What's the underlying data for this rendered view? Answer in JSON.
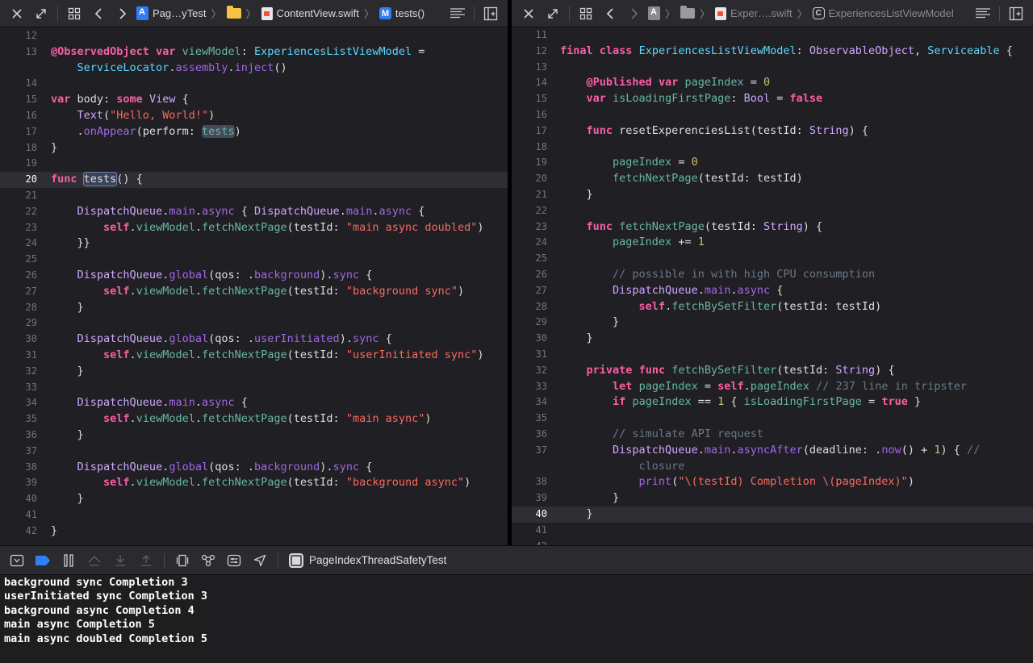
{
  "left_editor": {
    "breadcrumbs": [
      "Pag…yTest",
      "ContentView.swift",
      "tests()"
    ],
    "current_line": 20,
    "lines": [
      {
        "n": "12",
        "t": ""
      },
      {
        "n": "13",
        "t": "@ObservedObject var viewModel: ExperiencesListViewModel ="
      },
      {
        "n": "",
        "t": "    ServiceLocator.assembly.inject()"
      },
      {
        "n": "14",
        "t": ""
      },
      {
        "n": "15",
        "t": "var body: some View {"
      },
      {
        "n": "16",
        "t": "    Text(\"Hello, World!\")"
      },
      {
        "n": "17",
        "t": "    .onAppear(perform: tests)"
      },
      {
        "n": "18",
        "t": "}"
      },
      {
        "n": "19",
        "t": ""
      },
      {
        "n": "20",
        "t": "func tests() {"
      },
      {
        "n": "21",
        "t": ""
      },
      {
        "n": "22",
        "t": "    DispatchQueue.main.async { DispatchQueue.main.async {"
      },
      {
        "n": "23",
        "t": "        self.viewModel.fetchNextPage(testId: \"main async doubled\")"
      },
      {
        "n": "24",
        "t": "    }}"
      },
      {
        "n": "25",
        "t": ""
      },
      {
        "n": "26",
        "t": "    DispatchQueue.global(qos: .background).sync {"
      },
      {
        "n": "27",
        "t": "        self.viewModel.fetchNextPage(testId: \"background sync\")"
      },
      {
        "n": "28",
        "t": "    }"
      },
      {
        "n": "29",
        "t": ""
      },
      {
        "n": "30",
        "t": "    DispatchQueue.global(qos: .userInitiated).sync {"
      },
      {
        "n": "31",
        "t": "        self.viewModel.fetchNextPage(testId: \"userInitiated sync\")"
      },
      {
        "n": "32",
        "t": "    }"
      },
      {
        "n": "33",
        "t": ""
      },
      {
        "n": "34",
        "t": "    DispatchQueue.main.async {"
      },
      {
        "n": "35",
        "t": "        self.viewModel.fetchNextPage(testId: \"main async\")"
      },
      {
        "n": "36",
        "t": "    }"
      },
      {
        "n": "37",
        "t": ""
      },
      {
        "n": "38",
        "t": "    DispatchQueue.global(qos: .background).sync {"
      },
      {
        "n": "39",
        "t": "        self.viewModel.fetchNextPage(testId: \"background async\")"
      },
      {
        "n": "40",
        "t": "    }"
      },
      {
        "n": "41",
        "t": ""
      },
      {
        "n": "42",
        "t": "}"
      }
    ]
  },
  "right_editor": {
    "breadcrumbs": [
      "Exper….swift",
      "ExperiencesListViewModel"
    ],
    "current_line": 40,
    "lines": [
      {
        "n": "11",
        "t": ""
      },
      {
        "n": "12",
        "t": "final class ExperiencesListViewModel: ObservableObject, Serviceable {"
      },
      {
        "n": "13",
        "t": ""
      },
      {
        "n": "14",
        "t": "    @Published var pageIndex = 0"
      },
      {
        "n": "15",
        "t": "    var isLoadingFirstPage: Bool = false"
      },
      {
        "n": "16",
        "t": ""
      },
      {
        "n": "17",
        "t": "    func resetExperenciesList(testId: String) {"
      },
      {
        "n": "18",
        "t": ""
      },
      {
        "n": "19",
        "t": "        pageIndex = 0"
      },
      {
        "n": "20",
        "t": "        fetchNextPage(testId: testId)"
      },
      {
        "n": "21",
        "t": "    }"
      },
      {
        "n": "22",
        "t": ""
      },
      {
        "n": "23",
        "t": "    func fetchNextPage(testId: String) {"
      },
      {
        "n": "24",
        "t": "        pageIndex += 1"
      },
      {
        "n": "25",
        "t": ""
      },
      {
        "n": "26",
        "t": "        // possible in with high CPU consumption"
      },
      {
        "n": "27",
        "t": "        DispatchQueue.main.async {"
      },
      {
        "n": "28",
        "t": "            self.fetchBySetFilter(testId: testId)"
      },
      {
        "n": "29",
        "t": "        }"
      },
      {
        "n": "30",
        "t": "    }"
      },
      {
        "n": "31",
        "t": ""
      },
      {
        "n": "32",
        "t": "    private func fetchBySetFilter(testId: String) {"
      },
      {
        "n": "33",
        "t": "        let pageIndex = self.pageIndex // 237 line in tripster"
      },
      {
        "n": "34",
        "t": "        if pageIndex == 1 { isLoadingFirstPage = true }"
      },
      {
        "n": "35",
        "t": ""
      },
      {
        "n": "36",
        "t": "        // simulate API request"
      },
      {
        "n": "37",
        "t": "        DispatchQueue.main.asyncAfter(deadline: .now() + 1) { //"
      },
      {
        "n": "",
        "t": "            closure"
      },
      {
        "n": "38",
        "t": "            print(\"\\(testId) Completion \\(pageIndex)\")"
      },
      {
        "n": "39",
        "t": "        }"
      },
      {
        "n": "40",
        "t": "    }"
      },
      {
        "n": "41",
        "t": ""
      },
      {
        "n": "42",
        "t": ""
      }
    ]
  },
  "debug_bar": {
    "scheme": "PageIndexThreadSafetyTest"
  },
  "console": {
    "lines": [
      "background sync Completion 3",
      "userInitiated sync Completion 3",
      "background async Completion 4",
      "main async Completion 5",
      "main async doubled Completion 5"
    ]
  },
  "colors": {
    "editor_bg": "#1f1f24",
    "keyword": "#fc5fa3",
    "string": "#fc6a5d",
    "number": "#d0bf69",
    "comment": "#6c7986",
    "type": "#d0a8ff",
    "project_type": "#5dd8ff",
    "accent": "#2f80f7"
  }
}
